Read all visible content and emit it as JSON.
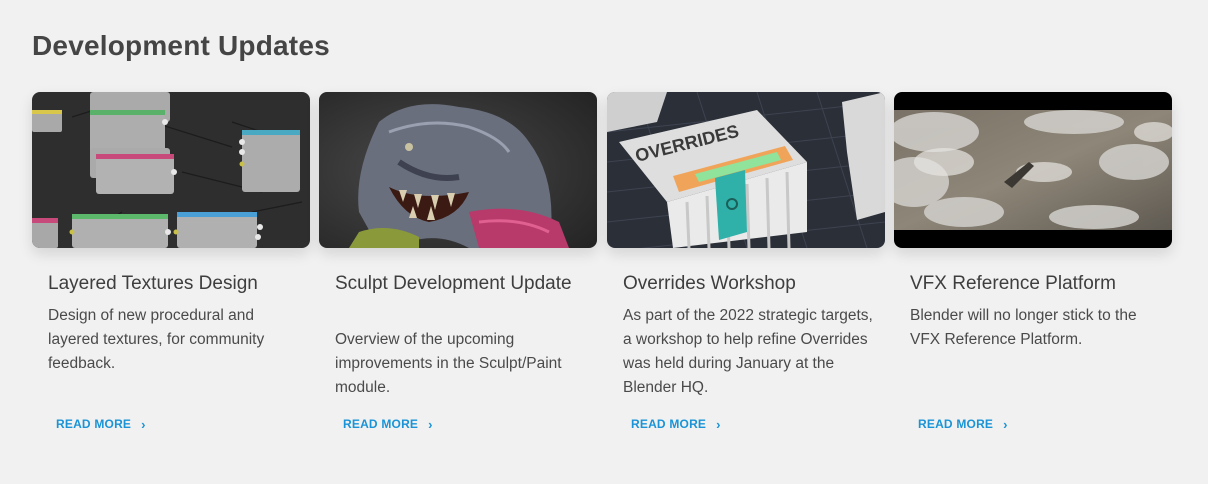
{
  "section": {
    "title": "Development Updates"
  },
  "cards": [
    {
      "title": "Layered Textures Design",
      "description": "Design of new procedural and layered textures, for community feedback.",
      "link_label": "READ MORE",
      "link_icon": "chevron-right-icon",
      "image": "node-editor-screenshot"
    },
    {
      "title": "Sculpt Development Update",
      "description": "Overview of the upcoming improvements in the Sculpt/Paint module.",
      "link_label": "READ MORE",
      "link_icon": "chevron-right-icon",
      "image": "sculpted-creature-render"
    },
    {
      "title": "Overrides Workshop",
      "description": "As part of the 2022 strategic targets, a workshop to help refine Overrides was held during January at the Blender HQ.",
      "image_text": "OVERRIDES",
      "link_label": "READ MORE",
      "link_icon": "chevron-right-icon",
      "image": "overrides-isometric-illustration"
    },
    {
      "title": "VFX Reference Platform",
      "description": "Blender will no longer stick to the VFX Reference Platform.",
      "link_label": "READ MORE",
      "link_icon": "chevron-right-icon",
      "image": "aerial-clouds-photo"
    }
  ],
  "colors": {
    "background": "#f1f1f1",
    "link": "#1a94d6",
    "title": "#454545"
  }
}
